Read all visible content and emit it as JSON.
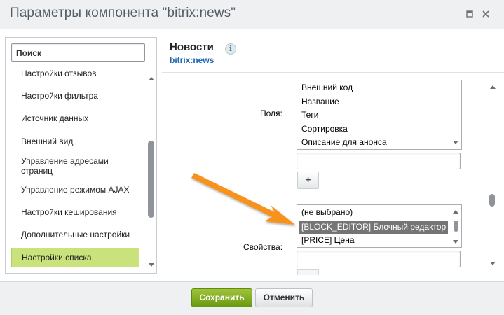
{
  "window": {
    "title": "Параметры компонента \"bitrix:news\"",
    "maximize_icon": "maximize-icon",
    "close_icon": "close-icon"
  },
  "sidebar": {
    "search_placeholder": "Поиск",
    "items": [
      {
        "label": "Настройки отзывов"
      },
      {
        "label": "Настройки фильтра"
      },
      {
        "label": "Источник данных"
      },
      {
        "label": "Внешний вид"
      },
      {
        "label": "Управление адресами страниц"
      },
      {
        "label": "Управление режимом AJAX"
      },
      {
        "label": "Настройки кеширования"
      },
      {
        "label": "Дополнительные настройки"
      },
      {
        "label": "Настройки списка"
      }
    ],
    "active_color": "#c9e27b"
  },
  "content": {
    "title": "Новости",
    "info_icon": "i",
    "subtitle": "bitrix:news",
    "fields": {
      "label": "Поля:",
      "options": [
        "Внешний код",
        "Название",
        "Теги",
        "Сортировка",
        "Описание для анонса"
      ],
      "add_label": "+"
    },
    "properties": {
      "label": "Свойства:",
      "options": [
        "(не выбрано)",
        "[BLOCK_EDITOR] Блочный редактор",
        "[PRICE] Цена"
      ],
      "selected": "[BLOCK_EDITOR] Блочный редактор"
    }
  },
  "footer": {
    "save_label": "Сохранить",
    "cancel_label": "Отменить"
  },
  "annotation": {
    "arrow_color": "#f7931e"
  }
}
